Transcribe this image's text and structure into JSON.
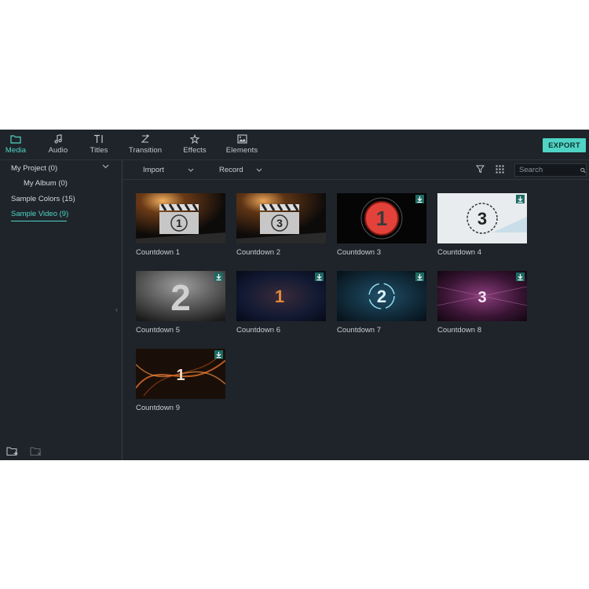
{
  "tabs": [
    {
      "label": "Media",
      "icon": "folder-icon",
      "active": true
    },
    {
      "label": "Audio",
      "icon": "music-note-icon",
      "active": false
    },
    {
      "label": "Titles",
      "icon": "text-icon",
      "active": false
    },
    {
      "label": "Transition",
      "icon": "transition-icon",
      "active": false
    },
    {
      "label": "Effects",
      "icon": "effects-icon",
      "active": false
    },
    {
      "label": "Elements",
      "icon": "image-icon",
      "active": false
    }
  ],
  "export_label": "EXPORT",
  "accent_color": "#4fd3c4",
  "sidebar": {
    "items": [
      {
        "label": "My Project (0)"
      },
      {
        "label": "My Album (0)"
      },
      {
        "label": "Sample Colors (15)"
      },
      {
        "label": "Sample Video (9)",
        "active": true
      }
    ]
  },
  "toolbar": {
    "import_label": "Import",
    "record_label": "Record",
    "search_placeholder": "Search"
  },
  "media": [
    {
      "caption": "Countdown 1",
      "number": "1",
      "downloadable": false
    },
    {
      "caption": "Countdown 2",
      "number": "3",
      "downloadable": false
    },
    {
      "caption": "Countdown 3",
      "number": "1",
      "downloadable": true
    },
    {
      "caption": "Countdown 4",
      "number": "3",
      "downloadable": true
    },
    {
      "caption": "Countdown 5",
      "number": "2",
      "downloadable": true
    },
    {
      "caption": "Countdown 6",
      "number": "1",
      "downloadable": true
    },
    {
      "caption": "Countdown 7",
      "number": "2",
      "downloadable": true
    },
    {
      "caption": "Countdown 8",
      "number": "3",
      "downloadable": true
    },
    {
      "caption": "Countdown 9",
      "number": "1",
      "downloadable": true
    }
  ]
}
